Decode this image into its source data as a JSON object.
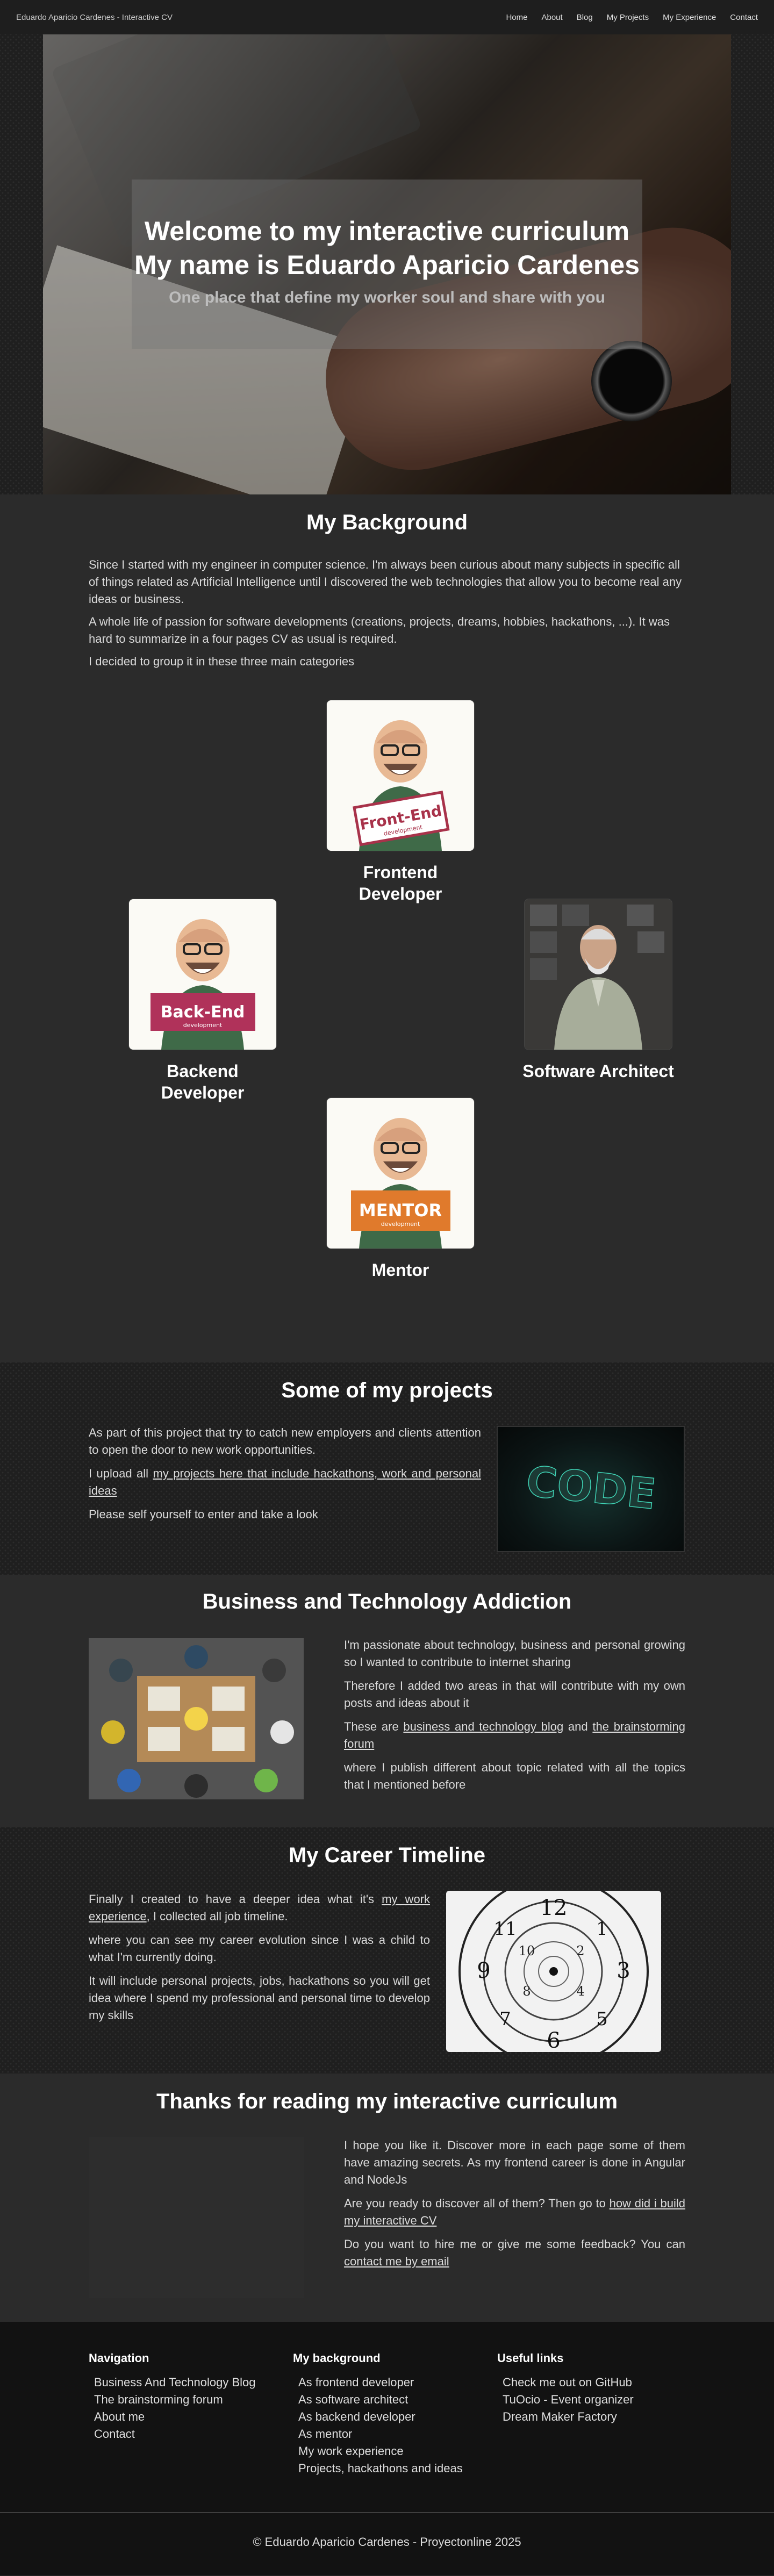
{
  "nav": {
    "brand": "Eduardo Aparicio Cardenes - Interactive CV",
    "links": [
      "Home",
      "About",
      "Blog",
      "My Projects",
      "My Experience",
      "Contact"
    ]
  },
  "hero": {
    "line1": "Welcome to my interactive curriculum",
    "line2": "My name is Eduardo Aparicio Cardenes",
    "subtitle": "One place that define my worker soul and share with you"
  },
  "background": {
    "title": "My Background",
    "p1": "Since I started with my engineer in computer science. I'm always been curious about many subjects in specific all of things related as Artificial Intelligence until I discovered the web technologies that allow you to become real any ideas or business.",
    "p2": "A whole life of passion for software developments (creations, projects, dreams, hobbies, hackathons, ...). It was hard to summarize in a four pages CV as usual is required.",
    "p3": "I decided to group it in these three main categories",
    "cards": {
      "frontend": {
        "label1": "Frontend",
        "label2": "Developer",
        "badge": "Front-End",
        "sub": "development",
        "color": "#a8324a"
      },
      "backend": {
        "label1": "Backend",
        "label2": "Developer",
        "badge": "Back-End",
        "sub": "development",
        "color": "#b0325a"
      },
      "architect": {
        "label1": "Software Architect"
      },
      "mentor": {
        "label1": "Mentor",
        "badge": "MENTOR",
        "sub": "development",
        "color": "#e07a2c"
      }
    }
  },
  "projects": {
    "title": "Some of my projects",
    "p1": "As part of this project that try to catch new employers and clients attention to open the door to new work opportunities.",
    "p2_before": "I upload all ",
    "p2_link": "my projects here that include hackathons, work and personal ideas",
    "p3": "Please self yourself to enter and take a look",
    "image_text": "CODE"
  },
  "business": {
    "title": "Business and Technology Addiction",
    "p1": "I'm passionate about technology, business and personal growing so I wanted to contribute to internet sharing",
    "p2": "Therefore I added two areas in that will contribute with my own posts and ideas about it",
    "p3_before": "These are ",
    "p3_link1": "business and technology blog",
    "p3_mid": " and ",
    "p3_link2": "the brainstorming forum",
    "p4": "where I publish different about topic related with all the topics that I mentioned before"
  },
  "timeline": {
    "title": "My Career Timeline",
    "p1_before": "Finally I created to have a deeper idea what it's ",
    "p1_link": "my work experience",
    "p1_after": ", I collected all job timeline.",
    "p2": "where you can see my career evolution since I was a child to what I'm currently doing.",
    "p3": "It will include personal projects, jobs, hackathons so you will get idea where I spend my professional and personal time to develop my skills"
  },
  "thanks": {
    "title": "Thanks for reading my interactive curriculum",
    "p1": "I hope you like it. Discover more in each page some of them have amazing secrets. As my frontend career is done in Angular and NodeJs",
    "p2_before": "Are you ready to discover all of them? Then go to ",
    "p2_link": "how did i build my interactive CV",
    "p3_before": "Do you want to hire me or give me some feedback? You can ",
    "p3_link": "contact me by email"
  },
  "footer": {
    "nav_title": "Navigation",
    "nav_items": [
      "Business And Technology Blog",
      "The brainstorming forum",
      "About me",
      "Contact"
    ],
    "bg_title": "My background",
    "bg_items": [
      "As frontend developer",
      "As software architect",
      "As backend developer",
      "As mentor",
      "My work experience",
      "Projects, hackathons and ideas"
    ],
    "links_title": "Useful links",
    "links_items": [
      "Check me out on GitHub",
      "TuOcio - Event organizer",
      "Dream Maker Factory"
    ],
    "copyright": "© Eduardo Aparicio Cardenes - Proyectonline 2025"
  }
}
